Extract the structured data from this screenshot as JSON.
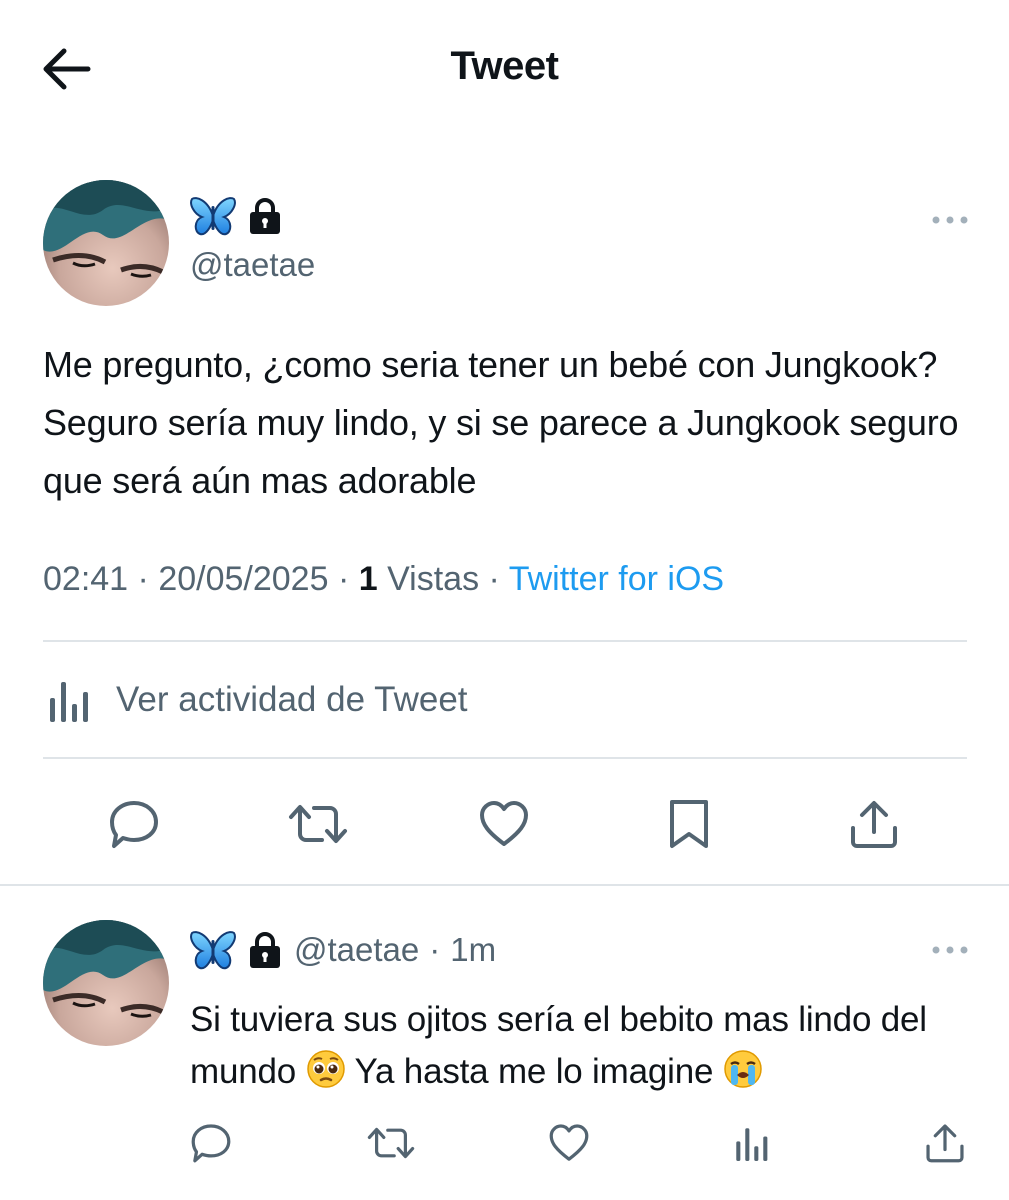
{
  "header": {
    "title": "Tweet",
    "back_icon": "arrow-left-icon"
  },
  "tweet": {
    "author": {
      "name_icons": [
        "butterfly-emoji",
        "lock-icon"
      ],
      "handle": "@taetae"
    },
    "text": "Me pregunto, ¿como seria tener un bebé con Jungkook? Seguro sería muy lindo, y si se parece a Jungkook seguro que será aún mas adorable",
    "meta": {
      "time": "02:41",
      "date": "20/05/2025",
      "sep": "·",
      "views_count": "1",
      "views_label": "Vistas",
      "source": "Twitter for iOS"
    },
    "activity_label": "Ver actividad de Tweet",
    "actions": [
      "reply-icon",
      "retweet-icon",
      "like-icon",
      "bookmark-icon",
      "share-icon"
    ]
  },
  "reply": {
    "author": {
      "name_icons": [
        "butterfly-emoji",
        "lock-icon"
      ],
      "handle": "@taetae",
      "time": "1m",
      "sep": "·"
    },
    "text_part1": "Si tuviera sus ojitos sería el bebito mas lindo del mundo",
    "text_part2": "Ya hasta me lo imagine",
    "emojis": [
      "pleading-face-emoji",
      "crying-face-emoji"
    ],
    "actions": [
      "reply-icon",
      "retweet-icon",
      "like-icon",
      "views-icon",
      "share-icon"
    ]
  },
  "colors": {
    "text": "#0f1419",
    "secondary": "#536471",
    "link": "#1d9bf0",
    "divider": "#dfe4e8"
  }
}
